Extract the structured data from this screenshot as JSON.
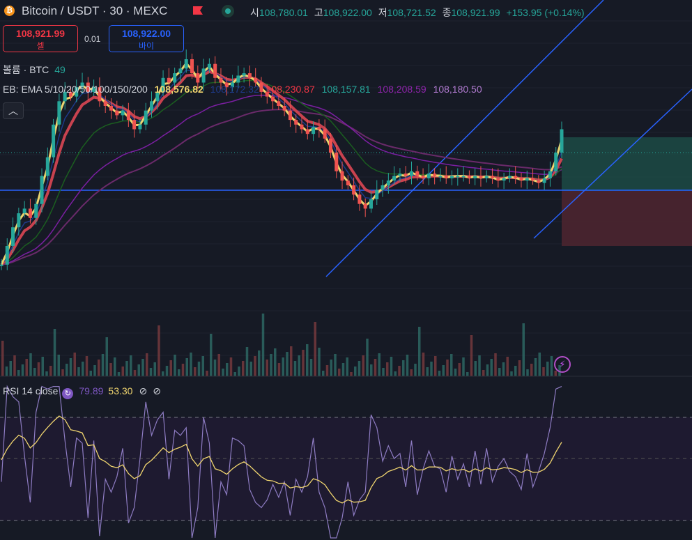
{
  "header": {
    "symbol_icon": "₿",
    "symbol": "Bitcoin / USDT · 30 · MEXC",
    "flag_color": "#f23645",
    "ohlc": [
      {
        "key": "시",
        "value": "108,780.01"
      },
      {
        "key": "고",
        "value": "108,922.00"
      },
      {
        "key": "저",
        "value": "108,721.52"
      },
      {
        "key": "종",
        "value": "108,921.99"
      }
    ],
    "change": "+153.95 (+0.14%)"
  },
  "trade": {
    "sell_price": "108,921.99",
    "sell_label": "셀",
    "spread": "0.01",
    "buy_price": "108,922.00",
    "buy_label": "바이"
  },
  "volume_legend": {
    "label": "볼륨 · BTC",
    "value": "49"
  },
  "ema_legend": {
    "label": "EB: EMA 5/10/20/50/100/150/200",
    "values": [
      {
        "text": "108,576.82",
        "color": "#ffeb3b"
      },
      {
        "text": "108,172.32",
        "color": "#1e3a8a"
      },
      {
        "text": "108,230.87",
        "color": "#f23645"
      },
      {
        "text": "108,157.81",
        "color": "#26a69a"
      },
      {
        "text": "108,208.59",
        "color": "#8e24aa"
      },
      {
        "text": "108,180.50",
        "color": "#b07ad0"
      }
    ]
  },
  "collapse_icon": "chevron-up",
  "rsi_legend": {
    "label": "RSI 14 close",
    "rsi": "79.89",
    "ma": "53.30",
    "icon": "⊘"
  },
  "colors": {
    "up": "#26a69a",
    "down": "#ef5350",
    "ema5": "#f0d56f",
    "ema10": "#1e3a8a",
    "ema20": "#c8424f",
    "ema50": "#1b5e20",
    "ema100": "#7b1fa2",
    "ema150": "#6a2a6a",
    "hline": "#2962ff",
    "rsi": "#7e57c2",
    "rsi_ma": "#f0d56f"
  },
  "chart_data": {
    "type": "candlestick",
    "note_values": "relative price scale, normalized 0-1 (top=1)",
    "price_close": [
      0.12,
      0.2,
      0.28,
      0.34,
      0.36,
      0.32,
      0.38,
      0.5,
      0.58,
      0.72,
      0.82,
      0.86,
      0.84,
      0.88,
      0.9,
      0.86,
      0.88,
      0.82,
      0.8,
      0.78,
      0.76,
      0.78,
      0.74,
      0.7,
      0.72,
      0.78,
      0.82,
      0.86,
      0.92,
      0.9,
      0.94,
      0.96,
      1.0,
      0.94,
      0.9,
      0.96,
      0.98,
      0.92,
      0.9,
      0.88,
      0.9,
      0.93,
      0.94,
      0.92,
      0.9,
      0.86,
      0.84,
      0.82,
      0.8,
      0.78,
      0.74,
      0.72,
      0.7,
      0.68,
      0.71,
      0.7,
      0.66,
      0.6,
      0.52,
      0.48,
      0.46,
      0.42,
      0.38,
      0.36,
      0.4,
      0.44,
      0.46,
      0.48,
      0.5,
      0.51,
      0.5,
      0.52,
      0.5,
      0.49,
      0.51,
      0.5,
      0.5,
      0.49,
      0.5,
      0.5,
      0.5,
      0.49,
      0.5,
      0.49,
      0.5,
      0.49,
      0.48,
      0.49,
      0.5,
      0.49,
      0.48,
      0.49,
      0.48,
      0.47,
      0.49,
      0.52,
      0.6,
      0.7
    ],
    "ema_close_lines": [
      "EMA5",
      "EMA10",
      "EMA20",
      "EMA50",
      "EMA100",
      "EMA150"
    ],
    "rsi": {
      "last": 79.89,
      "ma_last": 53.3,
      "bands": [
        30,
        50,
        70
      ]
    }
  }
}
